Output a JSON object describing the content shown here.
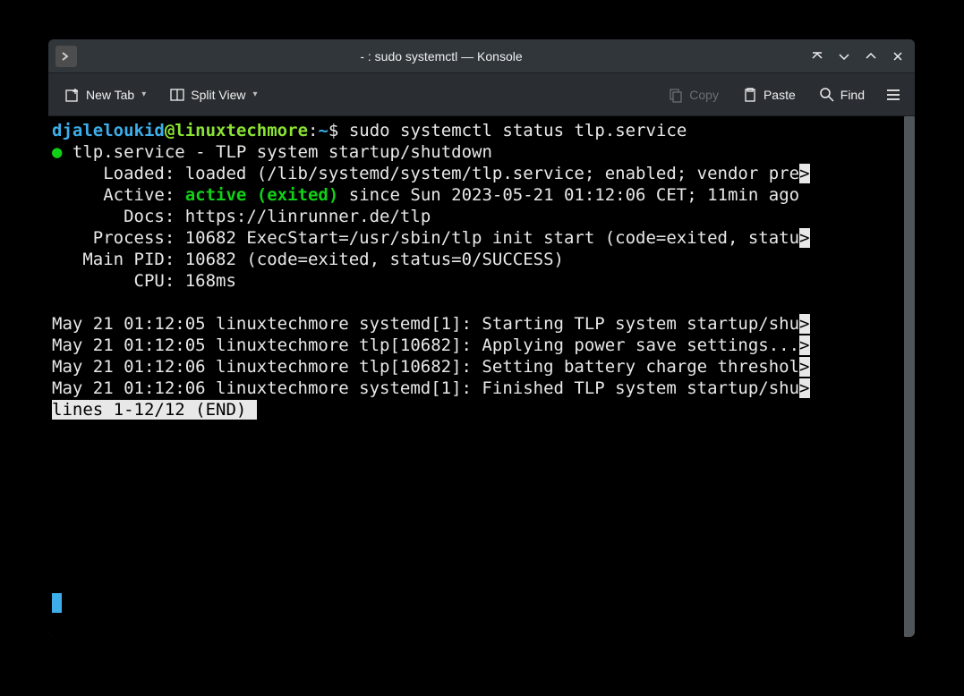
{
  "titlebar": {
    "title": "- : sudo systemctl — Konsole"
  },
  "toolbar": {
    "new_tab": "New Tab",
    "split_view": "Split View",
    "copy": "Copy",
    "paste": "Paste",
    "find": "Find"
  },
  "prompt": {
    "user": "djaleloukid",
    "at": "@",
    "host": "linuxtechmore",
    "colon": ":",
    "path": "~",
    "dollar": "$",
    "command": "sudo systemctl status tlp.service"
  },
  "output": {
    "bullet": "●",
    "service_line": " tlp.service - TLP system startup/shutdown",
    "loaded_label": "     Loaded: ",
    "loaded_value": "loaded (/lib/systemd/system/tlp.service; enabled; vendor pre",
    "active_label": "     Active: ",
    "active_value": "active (exited)",
    "active_rest": " since Sun 2023-05-21 01:12:06 CET; 11min ago",
    "docs_label": "       Docs: ",
    "docs_value": "https://linrunner.de/tlp",
    "process_label": "    Process: ",
    "process_value": "10682 ExecStart=/usr/sbin/tlp init start (code=exited, statu",
    "mainpid_label": "   Main PID: ",
    "mainpid_value": "10682 (code=exited, status=0/SUCCESS)",
    "cpu_label": "        CPU: ",
    "cpu_value": "168ms",
    "log1": "May 21 01:12:05 linuxtechmore systemd[1]: Starting TLP system startup/shu",
    "log2": "May 21 01:12:05 linuxtechmore tlp[10682]: Applying power save settings...",
    "log3": "May 21 01:12:06 linuxtechmore tlp[10682]: Setting battery charge threshol",
    "log4": "May 21 01:12:06 linuxtechmore systemd[1]: Finished TLP system startup/shu",
    "pager": "lines 1-12/12 (END) ",
    "gt": ">"
  }
}
